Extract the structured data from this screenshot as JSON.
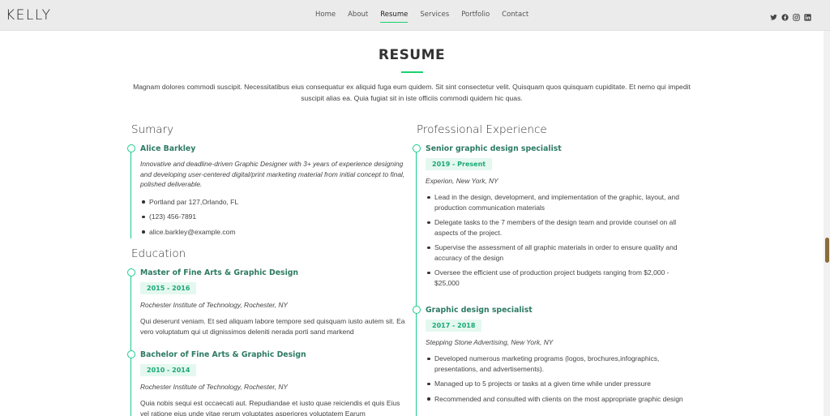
{
  "header": {
    "logo": "KELLY",
    "nav": [
      "Home",
      "About",
      "Resume",
      "Services",
      "Portfolio",
      "Contact"
    ],
    "active_nav": "Resume",
    "social_icons": [
      "twitter-icon",
      "facebook-icon",
      "instagram-icon",
      "linkedin-icon"
    ]
  },
  "section": {
    "title": "RESUME",
    "description": "Magnam dolores commodi suscipit. Necessitatibus eius consequatur ex aliquid fuga eum quidem. Sit sint consectetur velit. Quisquam quos quisquam cupiditate. Et nemo qui impedit suscipit alias ea. Quia fugiat sit in iste officiis commodi quidem hic quas."
  },
  "summary": {
    "heading": "Sumary",
    "name": "Alice Barkley",
    "bio": "Innovative and deadline-driven Graphic Designer with 3+ years of experience designing and developing user-centered digital/print marketing material from initial concept to final, polished deliverable.",
    "contacts": [
      "Portland par 127,Orlando, FL",
      "(123) 456-7891",
      "alice.barkley@example.com"
    ]
  },
  "education": {
    "heading": "Education",
    "items": [
      {
        "title": "Master of Fine Arts & Graphic Design",
        "years": "2015 - 2016",
        "org": "Rochester Institute of Technology, Rochester, NY",
        "text": "Qui deserunt veniam. Et sed aliquam labore tempore sed quisquam iusto autem sit. Ea vero voluptatum qui ut dignissimos deleniti nerada porti sand markend"
      },
      {
        "title": "Bachelor of Fine Arts & Graphic Design",
        "years": "2010 - 2014",
        "org": "Rochester Institute of Technology, Rochester, NY",
        "text": "Quia nobis sequi est occaecati aut. Repudiandae et iusto quae reiciendis et quis Eius vel ratione eius unde vitae rerum voluptates asperiores voluptatem Earum"
      }
    ]
  },
  "experience": {
    "heading": "Professional Experience",
    "items": [
      {
        "title": "Senior graphic design specialist",
        "years": "2019 - Present",
        "org": "Experion, New York, NY",
        "bullets": [
          "Lead in the design, development, and implementation of the graphic, layout, and production communication materials",
          "Delegate tasks to the 7 members of the design team and provide counsel on all aspects of the project.",
          "Supervise the assessment of all graphic materials in order to ensure quality and accuracy of the design",
          "Oversee the efficient use of production project budgets ranging from $2,000 - $25,000"
        ]
      },
      {
        "title": "Graphic design specialist",
        "years": "2017 - 2018",
        "org": "Stepping Stone Advertising, New York, NY",
        "bullets": [
          "Developed numerous marketing programs (logos, brochures,infographics, presentations, and advertisements).",
          "Managed up to 5 projects or tasks at a given time while under pressure",
          "Recommended and consulted with clients on the most appropriate graphic design"
        ]
      }
    ]
  },
  "colors": {
    "accent": "#18d26e",
    "title_green": "#2c7a63",
    "badge_bg": "#e4f8f0"
  }
}
